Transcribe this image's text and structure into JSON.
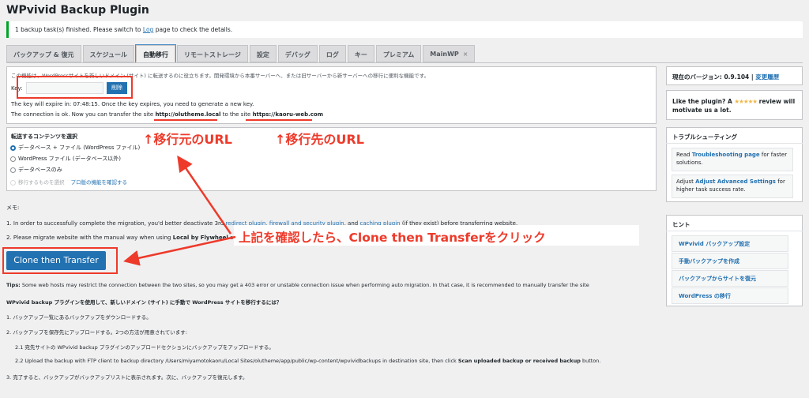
{
  "page_title": "WPvivid Backup Plugin",
  "notice": {
    "before": "1 backup task(s) finished. Please switch to ",
    "link": "Log",
    "after": " page to check the details."
  },
  "tabs": [
    {
      "label": "バックアップ & 復元",
      "active": false
    },
    {
      "label": "スケジュール",
      "active": false
    },
    {
      "label": "自動移行",
      "active": true
    },
    {
      "label": "リモートストレージ",
      "active": false
    },
    {
      "label": "設定",
      "active": false
    },
    {
      "label": "デバッグ",
      "active": false
    },
    {
      "label": "ログ",
      "active": false
    },
    {
      "label": "キー",
      "active": false
    },
    {
      "label": "プレミアム",
      "active": false
    },
    {
      "label": "MainWP",
      "active": false,
      "closable": true,
      "close_glyph": "×"
    }
  ],
  "key_section": {
    "intro": "この機能は、WordPressサイトを新しいドメイン (サイト) に転送するのに役立ちます。開発環境から本番サーバーへ、または旧サーバーから新サーバーへの移行に便利な機能です。",
    "key_label": "Key:",
    "key_value": "",
    "delete_button": "削除",
    "expire_text": "The key will expire in: 07:48:15. Once the key expires, you need to generate a new key.",
    "connection_before": "The connection is ok. Now you can transfer the site ",
    "source_url": "http://olutheme.local",
    "connection_mid": " to the site ",
    "dest_url": "https://kaoru-web.com"
  },
  "content_select": {
    "heading": "転送するコンテンツを選択",
    "options": [
      {
        "label": "データベース + ファイル (WordPress ファイル)",
        "checked": true,
        "disabled": false
      },
      {
        "label": "WordPress ファイル (データベース以外)",
        "checked": false,
        "disabled": false
      },
      {
        "label": "データベースのみ",
        "checked": false,
        "disabled": false
      },
      {
        "label": "移行するものを選択",
        "checked": false,
        "disabled": true
      }
    ],
    "pro_link": "プロ版の機能を確認する"
  },
  "memo": {
    "heading": "メモ:",
    "line1_before": "1. In order to successfully complete the migration, you'd better deactivate 3rd ",
    "line1_links": "redirect plugin, firewall and security plugin",
    "line1_mid": ", and ",
    "line1_link2": "caching plugin",
    "line1_after": " (if they exist) before transferring website.",
    "line2_before": "2. Please migrate website with the manual way when using ",
    "line2_bold": "Local by Flywheel",
    "line2_after": " env"
  },
  "clone_button": "Clone then Transfer",
  "tips": {
    "label": "Tips:",
    "text": " Some web hosts may restrict the connection between the two sites, so you may get a 403 error or unstable connection issue when performing auto migration. In that case, it is recommended to manually transfer the site"
  },
  "manual": {
    "heading": "WPvivid backup プラグインを使用して、新しいドメイン (サイト) に手動で WordPress サイトを移行するには？",
    "step1": "1. バックアップ一覧にあるバックアップをダウンロードする。",
    "step2": "2. バックアップを保存先にアップロードする。2つの方法が用意されています:",
    "step21": "2.1 宛先サイトの WPvivid backup プラグインのアップロードセクションにバックアップをアップロードする。",
    "step22_before": "2.2 Upload the backup with FTP client to backup directory /Users/miyamotokaoru/Local Sites/olutheme/app/public/wp-content/wpvividbackups in destination site, then click ",
    "step22_bold": "Scan uploaded backup or received backup",
    "step22_after": " button.",
    "step3": "3. 完了すると、バックアップがバックアップリストに表示されます。次に、バックアップを復元します。"
  },
  "annotations": {
    "source_label": "↑移行元のURL",
    "dest_label": "↑移行先のURL",
    "instruction": "上記を確認したら、Clone then Transferをクリック"
  },
  "sidebar": {
    "version_label": "現在のバージョン: 0.9.104",
    "changelog_link": "変更履歴",
    "like_before": "Like the plugin? A ",
    "like_stars": "★★★★★",
    "like_after": " review will motivate us a lot.",
    "trouble_heading": "トラブルシューティング",
    "trouble1_before": "Read ",
    "trouble1_link": "Troubleshooting page",
    "trouble1_after": " for faster solutions.",
    "trouble2_before": "Adjust ",
    "trouble2_link": "Adjust Advanced Settings",
    "trouble2_after": " for higher task success rate.",
    "hints_heading": "ヒント",
    "hints": [
      "WPvivid バックアップ設定",
      "手動バックアップを作成",
      "バックアップからサイトを復元",
      "WordPress の移行"
    ]
  },
  "colors": {
    "accent": "#2271b1",
    "annotation": "#ee3a2a",
    "success": "#00a32a"
  }
}
